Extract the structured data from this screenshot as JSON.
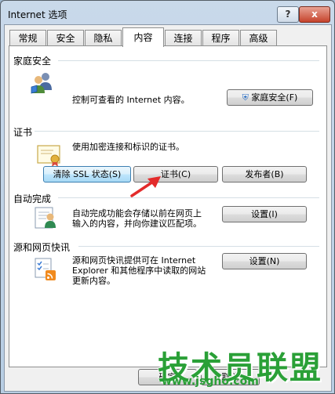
{
  "window": {
    "title": "Internet 选项",
    "help_glyph": "?",
    "close_glyph": "x"
  },
  "tabs": [
    {
      "label": "常规"
    },
    {
      "label": "安全"
    },
    {
      "label": "隐私"
    },
    {
      "label": "内容",
      "active": true
    },
    {
      "label": "连接"
    },
    {
      "label": "程序"
    },
    {
      "label": "高级"
    }
  ],
  "family_safety": {
    "heading": "家庭安全",
    "description": "控制可查看的 Internet 内容。",
    "button": "家庭安全(F)"
  },
  "certificates": {
    "heading": "证书",
    "description": "使用加密连接和标识的证书。",
    "clear_ssl_button": "清除 SSL 状态(S)",
    "certificates_button": "证书(C)",
    "publishers_button": "发布者(B)"
  },
  "autocomplete": {
    "heading": "自动完成",
    "description_line1": "自动完成功能会存储以前在网页上",
    "description_line2": "输入的内容，并向你建议匹配项。",
    "button": "设置(I)"
  },
  "feeds": {
    "heading": "源和网页快讯",
    "description_line1": "源和网页快讯提供可在 Internet",
    "description_line2": "Explorer 和其他程序中读取的网站",
    "description_line3": "更新内容。",
    "button": "设置(N)"
  },
  "footer": {
    "ok_button": "确定",
    "cancel_button": "取消"
  },
  "watermark": {
    "title": "技术员联盟",
    "url": "www.jsgho.com"
  },
  "colors": {
    "arrow": "#e32b2b",
    "watermark": "#2aa037",
    "focus_border": "#3c7fb1"
  }
}
